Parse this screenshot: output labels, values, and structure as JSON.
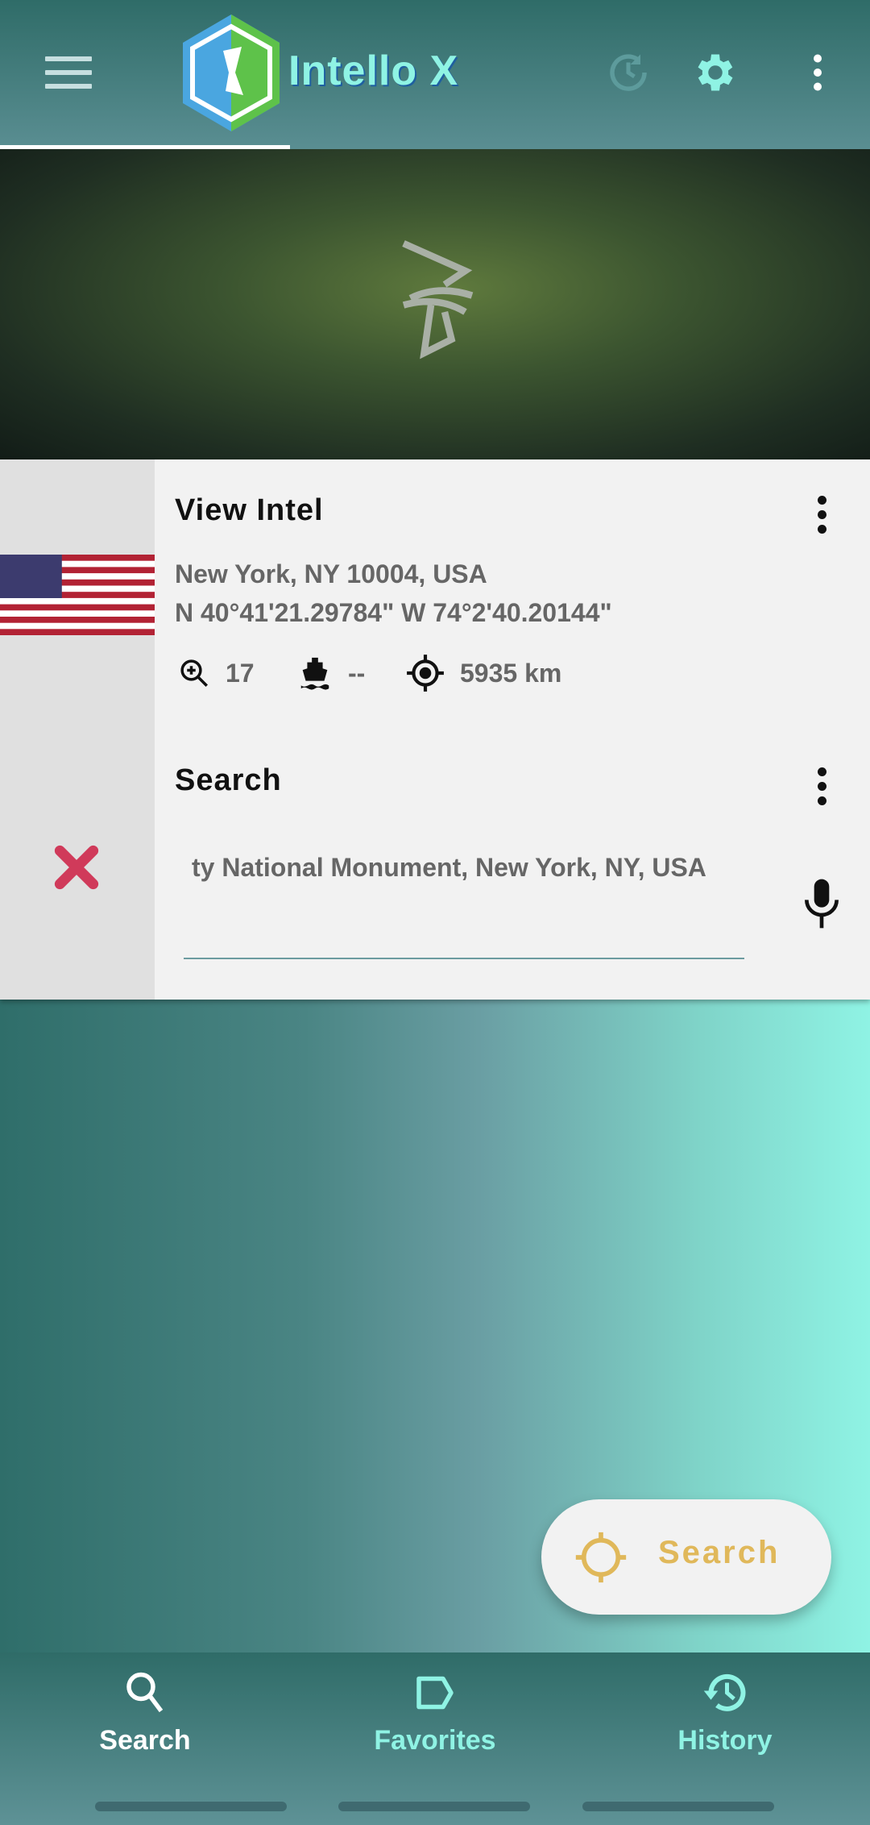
{
  "header": {
    "title": "Intello X",
    "icons": [
      "menu-icon",
      "history-refresh-icon",
      "settings-icon",
      "more-vert-icon"
    ],
    "accent": "#8ff3e4"
  },
  "intel": {
    "title": "View Intel",
    "address": "New York, NY 10004, USA",
    "coordinates": "N 40°41'21.29784\" W 74°2'40.20144\"",
    "zoom": "17",
    "ship": "--",
    "distance": "5935 km"
  },
  "search": {
    "title": "Search",
    "value": "ty National Monument, New York, NY, USA"
  },
  "fab": {
    "label": "Search",
    "color": "#e0b85a"
  },
  "nav": {
    "items": [
      {
        "label": "Search",
        "active": true
      },
      {
        "label": "Favorites",
        "active": false
      },
      {
        "label": "History",
        "active": false
      }
    ]
  }
}
